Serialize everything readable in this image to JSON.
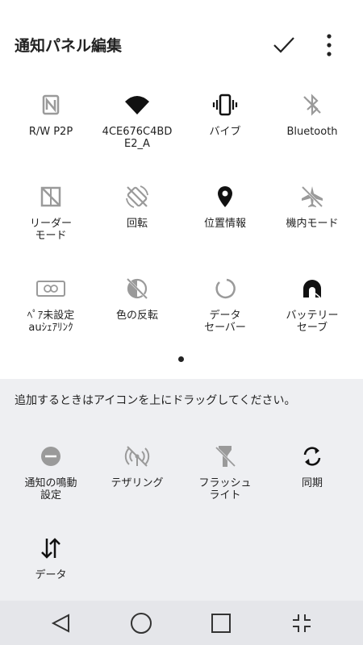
{
  "header": {
    "title": "通知パネル編集"
  },
  "active_tiles": [
    {
      "label": "R/W P2P"
    },
    {
      "label": "4CE676C4BD\nE2_A"
    },
    {
      "label": "バイブ"
    },
    {
      "label": "Bluetooth"
    },
    {
      "label": "リーダー\nモード"
    },
    {
      "label": "回転"
    },
    {
      "label": "位置情報"
    },
    {
      "label": "機内モード"
    },
    {
      "label": "ﾍﾟｱ未設定\nauｼｪｱﾘﾝｸ"
    },
    {
      "label": "色の反転"
    },
    {
      "label": "データ\nセーバー"
    },
    {
      "label": "バッテリー\nセーブ"
    }
  ],
  "tray": {
    "hint": "追加するときはアイコンを上にドラッグしてください。",
    "tiles": [
      {
        "label": "通知の鳴動\n設定"
      },
      {
        "label": "テザリング"
      },
      {
        "label": "フラッシュ\nライト"
      },
      {
        "label": "同期"
      },
      {
        "label": "データ"
      }
    ]
  },
  "colors": {
    "icon_on": "#111111",
    "icon_off": "#9a9a9a",
    "tray_bg": "#eeeff2",
    "nav_bg": "#e5e6ea"
  }
}
